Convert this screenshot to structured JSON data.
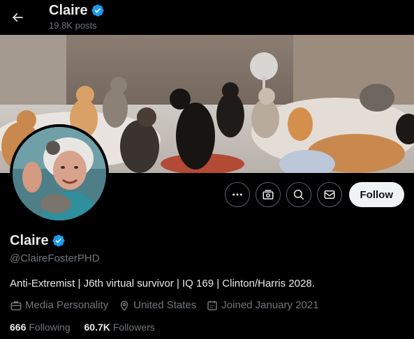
{
  "header": {
    "name": "Claire",
    "posts_count": "19.8K posts",
    "back_icon": "arrow-left-icon",
    "verified_icon": "verified-badge-icon"
  },
  "profile": {
    "display_name": "Claire",
    "handle": "@ClaireFosterPHD",
    "bio": "Anti-Extremist | J6th virtual survivor | IQ 169 | Clinton/Harris 2028.",
    "category": "Media Personality",
    "location": "United States",
    "joined": "Joined January 2021",
    "following_count": "666",
    "following_label": "Following",
    "followers_count": "60.7K",
    "followers_label": "Followers"
  },
  "actions": {
    "more_icon": "more-icon",
    "subscribe_icon": "money-icon",
    "search_icon": "search-icon",
    "message_icon": "mail-icon",
    "follow_label": "Follow"
  },
  "colors": {
    "background": "#000000",
    "text_primary": "#e7e9ea",
    "text_secondary": "#71767b",
    "verified": "#1d9bf0",
    "follow_bg": "#eff3f4",
    "follow_text": "#0f1419"
  }
}
